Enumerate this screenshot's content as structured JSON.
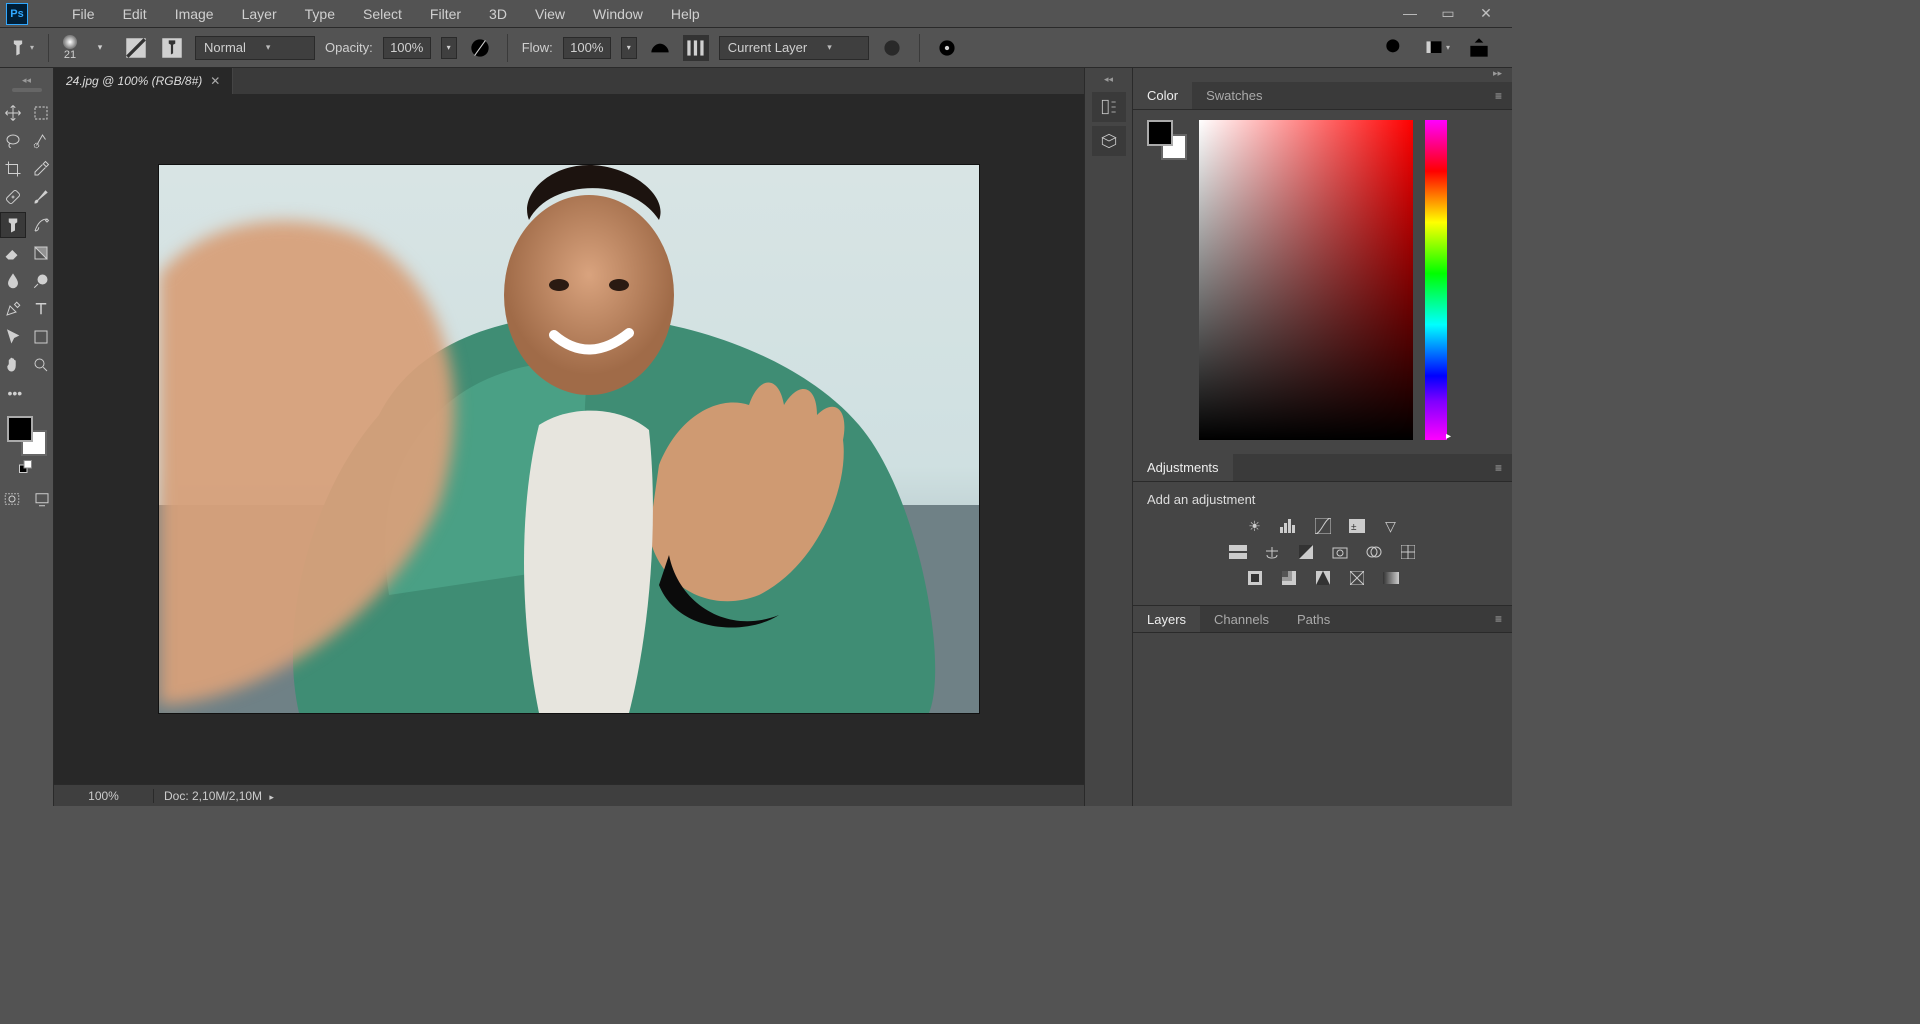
{
  "app": {
    "logo": "Ps"
  },
  "menu": [
    "File",
    "Edit",
    "Image",
    "Layer",
    "Type",
    "Select",
    "Filter",
    "3D",
    "View",
    "Window",
    "Help"
  ],
  "options": {
    "brush_size": "21",
    "blend_mode": "Normal",
    "opacity_label": "Opacity:",
    "opacity_value": "100%",
    "flow_label": "Flow:",
    "flow_value": "100%",
    "sample_mode": "Current Layer"
  },
  "document": {
    "tab_title": "24.jpg @ 100% (RGB/8#)",
    "zoom": "100%",
    "doc_info": "Doc: 2,10M/2,10M"
  },
  "panels": {
    "color_tab": "Color",
    "swatches_tab": "Swatches",
    "adjustments_tab": "Adjustments",
    "add_adjustment": "Add an adjustment",
    "layers_tab": "Layers",
    "channels_tab": "Channels",
    "paths_tab": "Paths"
  }
}
